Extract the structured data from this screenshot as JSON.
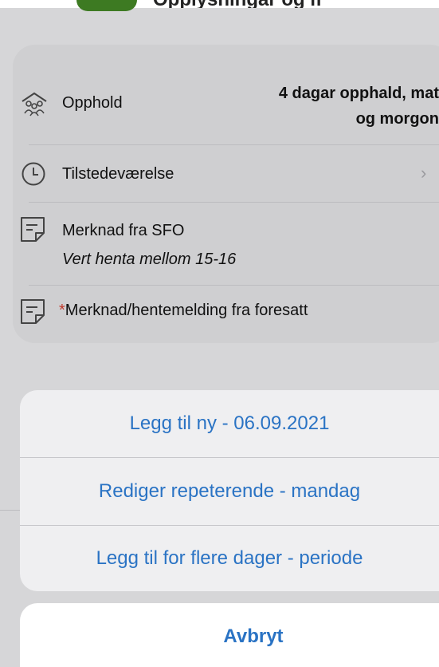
{
  "top": {
    "partial_title": "Opplysningar og meldingar"
  },
  "details": {
    "opphold_label": "Opphold",
    "opphold_value_line1": "4 dagar opphald, mat",
    "opphold_value_line2": "og morgon",
    "tilstede_label": "Tilstedeværelse",
    "sfo_note_label": "Merknad fra SFO",
    "sfo_note_text": "Vert henta mellom 15-16",
    "required_marker": "*",
    "guardian_note_label": "Merknad/hentemelding fra foresatt"
  },
  "action_sheet": {
    "items": [
      {
        "label": "Legg til ny - 06.09.2021"
      },
      {
        "label": "Rediger repeterende - mandag"
      },
      {
        "label": "Legg til for flere dager - periode"
      }
    ],
    "cancel_label": "Avbryt"
  },
  "colors": {
    "accent": "#2a73c4",
    "app_icon": "#3d7a22",
    "dim_background": "#d6d6d8"
  },
  "icons": {
    "opphold": "people-group-icon",
    "tilstede": "clock-icon",
    "sfo_note": "note-icon",
    "guardian_note": "note-icon",
    "chevron": "chevron-right-icon"
  }
}
